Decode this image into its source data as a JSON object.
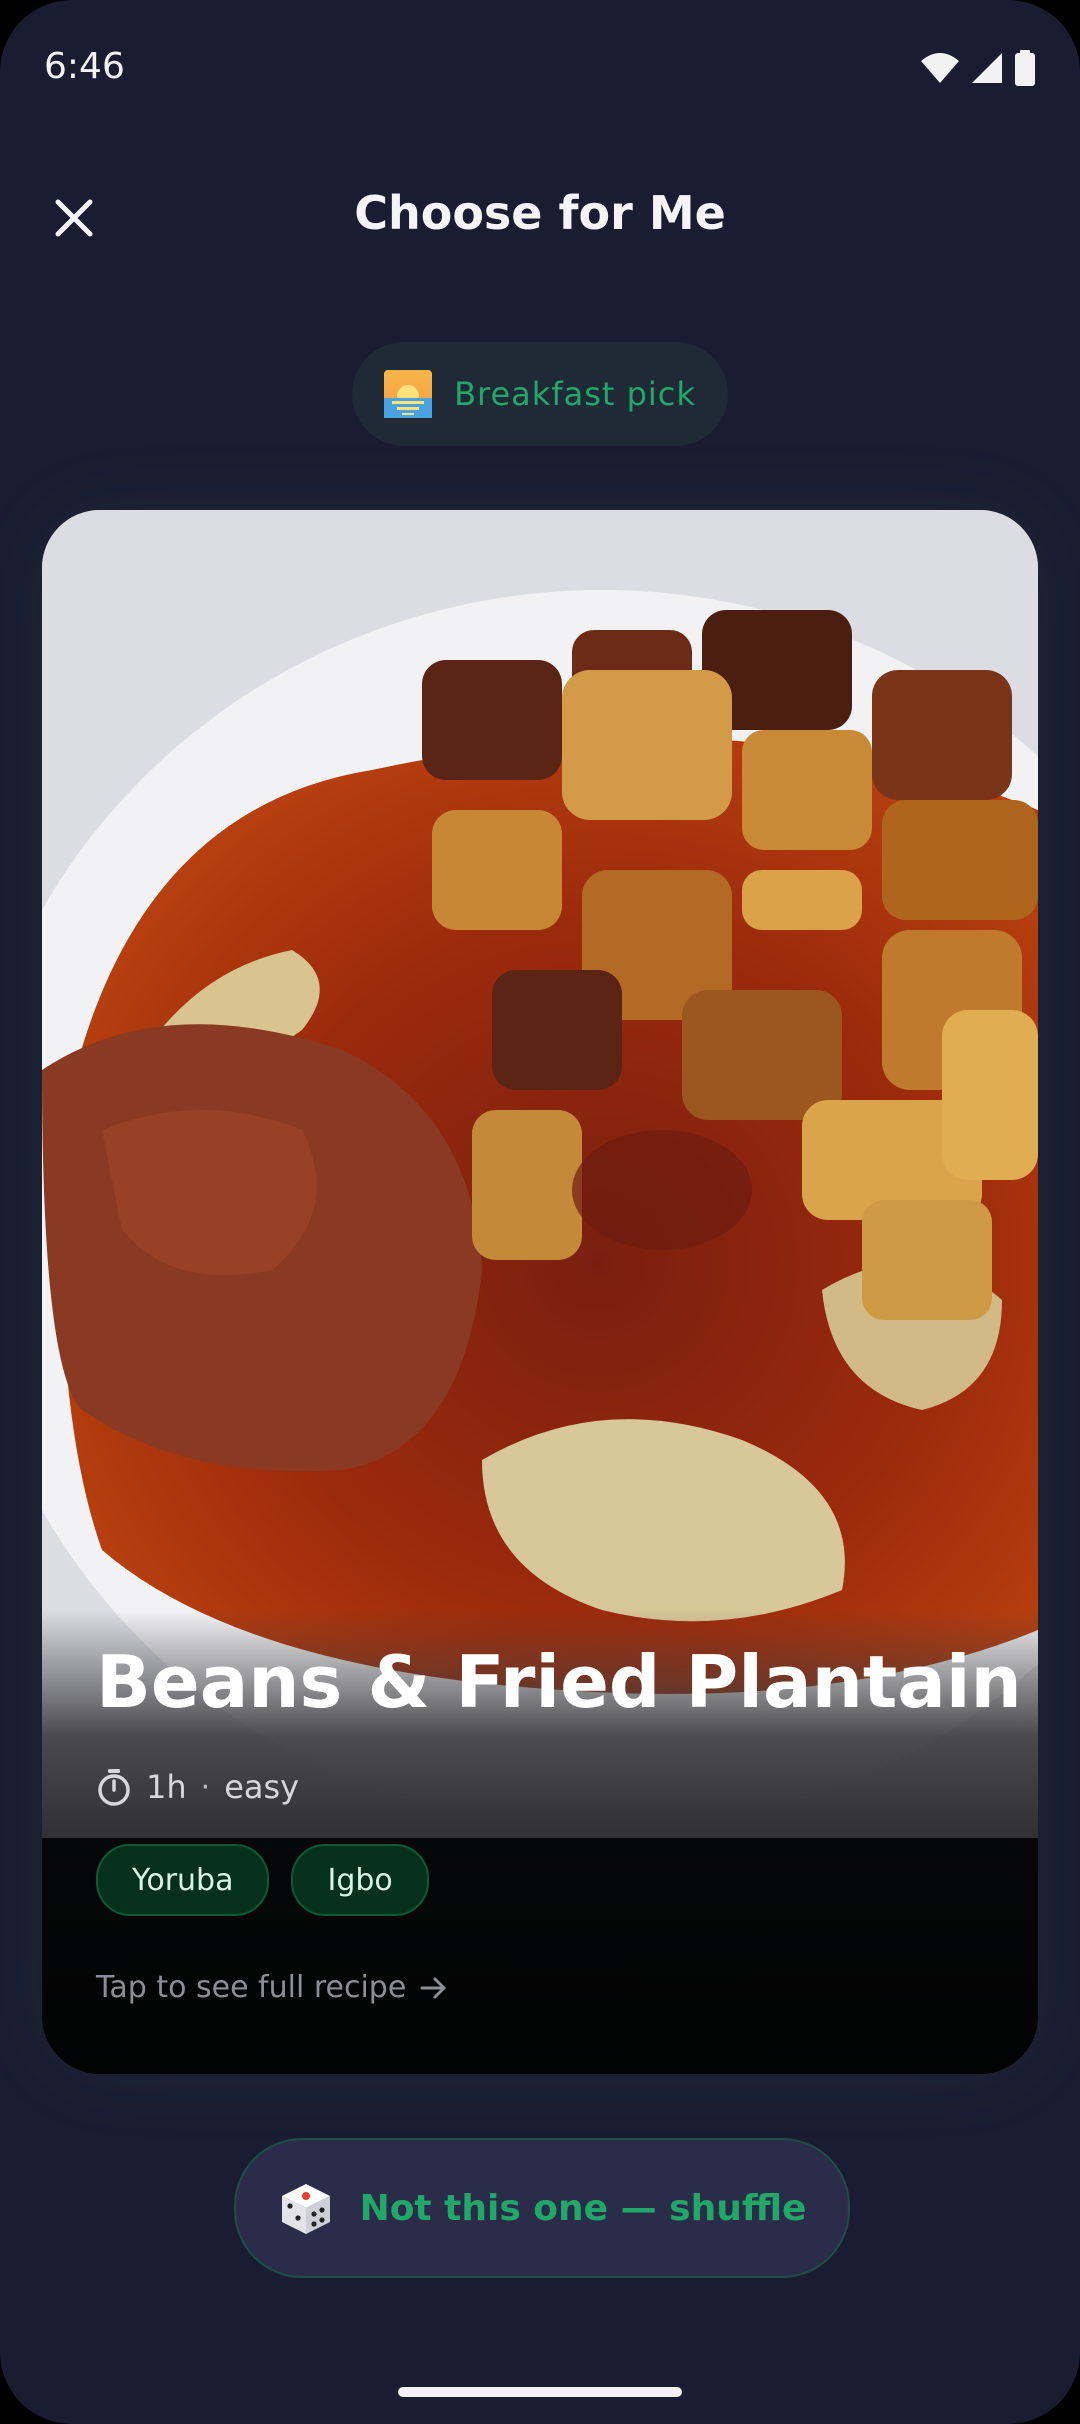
{
  "status_bar": {
    "time": "6:46"
  },
  "header": {
    "title": "Choose for Me"
  },
  "meal_pill": {
    "label": "Breakfast pick",
    "icon": "sunrise-icon"
  },
  "recipe": {
    "title": "Beans & Fried Plantain",
    "duration": "1h",
    "difficulty": "easy",
    "tags": [
      "Yoruba",
      "Igbo"
    ],
    "cta": "Tap to see full recipe",
    "image": "food-photo-plate-of-beans-plantain-stew"
  },
  "shuffle_button": {
    "label": "Not this one — shuffle",
    "icon": "dice-icon"
  },
  "colors": {
    "accent": "#22a86a",
    "background": "#1a1d31",
    "chip_bg": "#04301c"
  }
}
